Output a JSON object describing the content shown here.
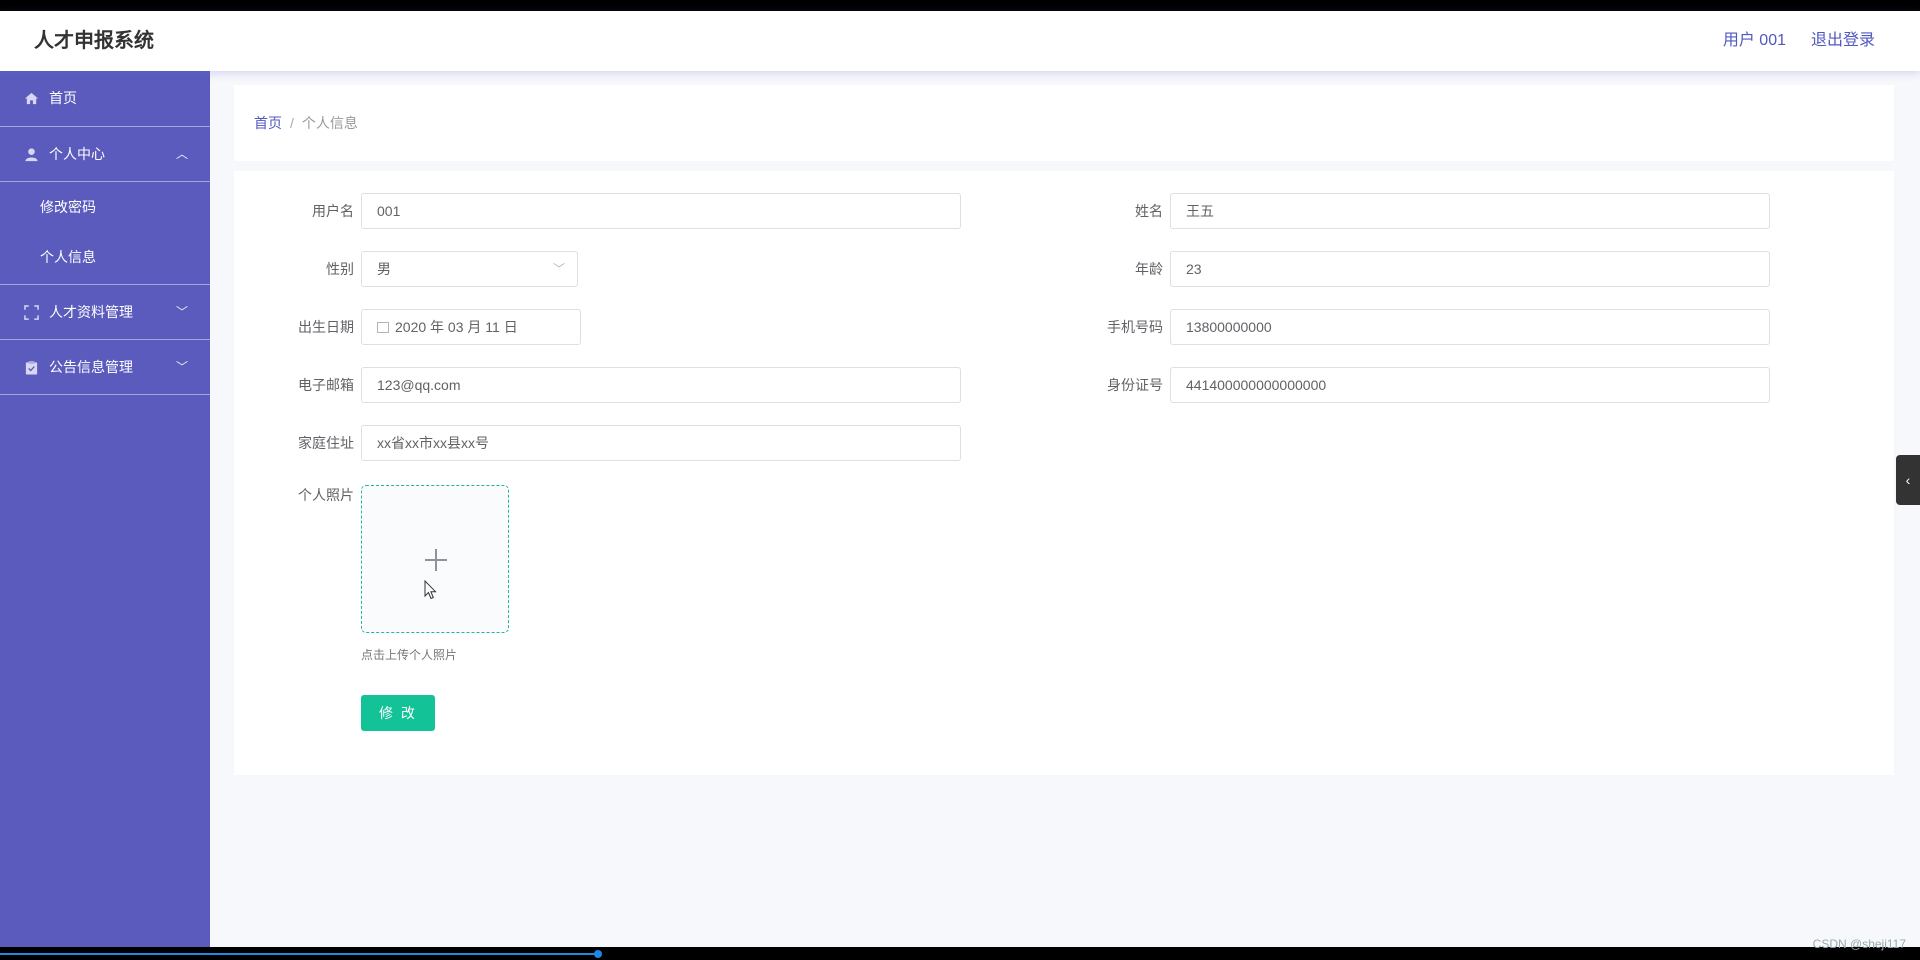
{
  "header": {
    "title": "人才申报系统",
    "user": "用户 001",
    "logout": "退出登录"
  },
  "sidebar": {
    "items": [
      {
        "label": "首页",
        "icon": "home-icon"
      },
      {
        "label": "个人中心",
        "icon": "user-icon",
        "expanded": true,
        "children": [
          "修改密码",
          "个人信息"
        ]
      },
      {
        "label": "人才资料管理",
        "icon": "frame-icon",
        "expanded": false
      },
      {
        "label": "公告信息管理",
        "icon": "clipboard-icon",
        "expanded": false
      }
    ]
  },
  "breadcrumb": {
    "home": "首页",
    "separator": "/",
    "current": "个人信息"
  },
  "form": {
    "username": {
      "label": "用户名",
      "value": "001"
    },
    "name": {
      "label": "姓名",
      "value": "王五"
    },
    "gender": {
      "label": "性别",
      "value": "男"
    },
    "age": {
      "label": "年龄",
      "value": "23"
    },
    "birthdate": {
      "label": "出生日期",
      "value": "2020 年 03 月 11 日"
    },
    "phone": {
      "label": "手机号码",
      "value": "13800000000"
    },
    "email": {
      "label": "电子邮箱",
      "value": "123@qq.com"
    },
    "idcard": {
      "label": "身份证号",
      "value": "441400000000000000"
    },
    "address": {
      "label": "家庭住址",
      "value": "xx省xx市xx县xx号"
    },
    "photo": {
      "label": "个人照片",
      "tip": "点击上传个人照片"
    },
    "submit": "修 改"
  },
  "watermark": "CSDN @sheji117",
  "colors": {
    "sidebar": "#5a5bbd",
    "accent": "#5158c0",
    "primary_button": "#13c297",
    "upload_border": "#21b6a0"
  }
}
